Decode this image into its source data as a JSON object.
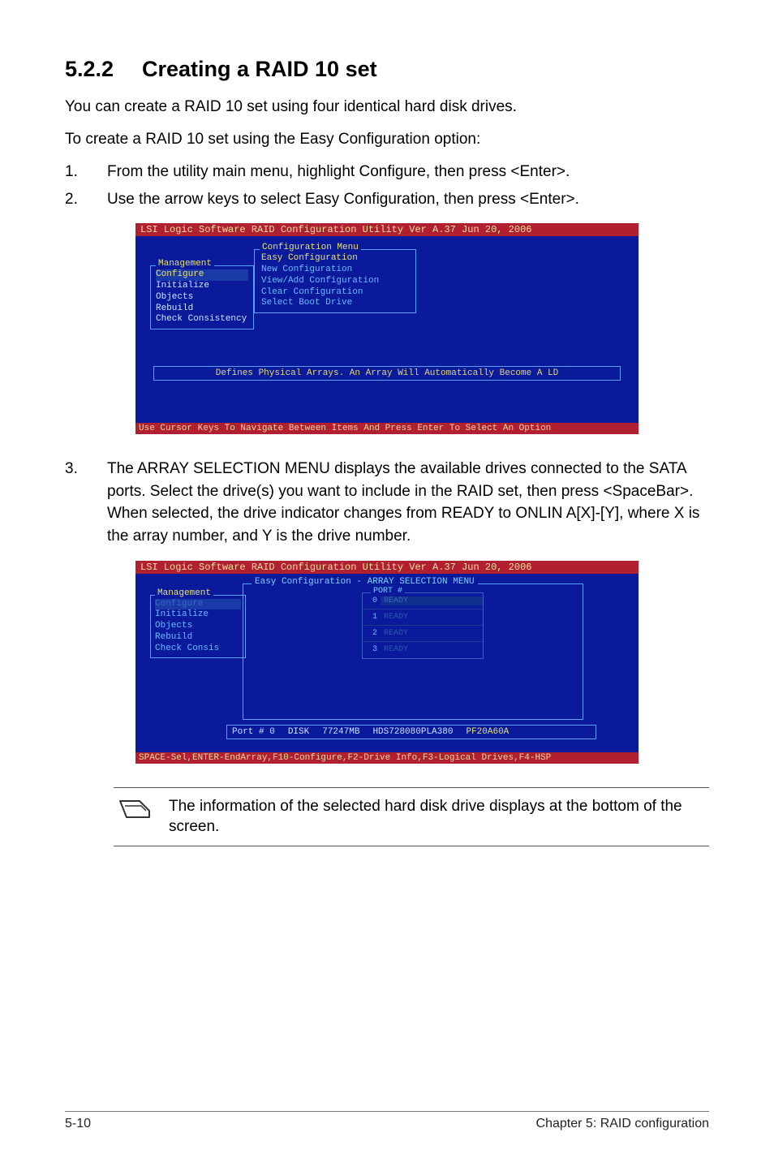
{
  "heading": {
    "number": "5.2.2",
    "title": "Creating a RAID 10 set"
  },
  "intro": [
    "You can create a RAID 10 set using four identical hard disk drives.",
    "To create a RAID 10 set using the Easy Configuration option:"
  ],
  "steps12": [
    {
      "n": "1.",
      "t": "From the utility main menu, highlight Configure, then press <Enter>."
    },
    {
      "n": "2.",
      "t": "Use the arrow keys to select Easy Configuration, then press <Enter>."
    }
  ],
  "bios1": {
    "title": "LSI Logic Software RAID Configuration Utility Ver A.37 Jun 20, 2006",
    "mgmt_label": "Management",
    "mgmt_items": [
      "Configure",
      "Initialize",
      "Objects",
      "Rebuild",
      "Check Consistency"
    ],
    "conf_label": "Configuration Menu",
    "conf_items": [
      "Easy Configuration",
      "New Configuration",
      "View/Add Configuration",
      "Clear Configuration",
      "Select Boot Drive"
    ],
    "hint": "Defines Physical Arrays. An Array Will Automatically Become A LD",
    "footer": "Use Cursor Keys To Navigate Between Items And Press Enter To Select An Option"
  },
  "step3": {
    "n": "3.",
    "t": "The ARRAY SELECTION MENU displays the available drives connected to the SATA ports. Select the drive(s) you want to include in the RAID set, then press <SpaceBar>. When selected, the drive indicator changes from READY  to ONLIN A[X]-[Y], where X is the array number, and Y is the drive number."
  },
  "bios2": {
    "title": "LSI Logic Software RAID Configuration Utility Ver A.37 Jun 20, 2006",
    "mgmt_label": "Management",
    "mgmt_items": [
      "Configure",
      "Initialize",
      "Objects",
      "Rebuild",
      "Check Consis"
    ],
    "arr_label": "Easy Configuration - ARRAY SELECTION MENU",
    "port_label": "PORT #",
    "ports": [
      {
        "n": "0",
        "v": "READY"
      },
      {
        "n": "1",
        "v": "READY"
      },
      {
        "n": "2",
        "v": "READY"
      },
      {
        "n": "3",
        "v": "READY"
      }
    ],
    "drive_info": {
      "port": "Port # 0",
      "disk": "DISK",
      "size": "77247MB",
      "model": "HDS728080PLA380",
      "fw": "PF20A60A"
    },
    "footer": "SPACE-Sel,ENTER-EndArray,F10-Configure,F2-Drive Info,F3-Logical Drives,F4-HSP"
  },
  "note": "The information of the selected hard disk drive displays at the bottom of the screen.",
  "footer": {
    "left": "5-10",
    "right": "Chapter 5: RAID configuration"
  }
}
